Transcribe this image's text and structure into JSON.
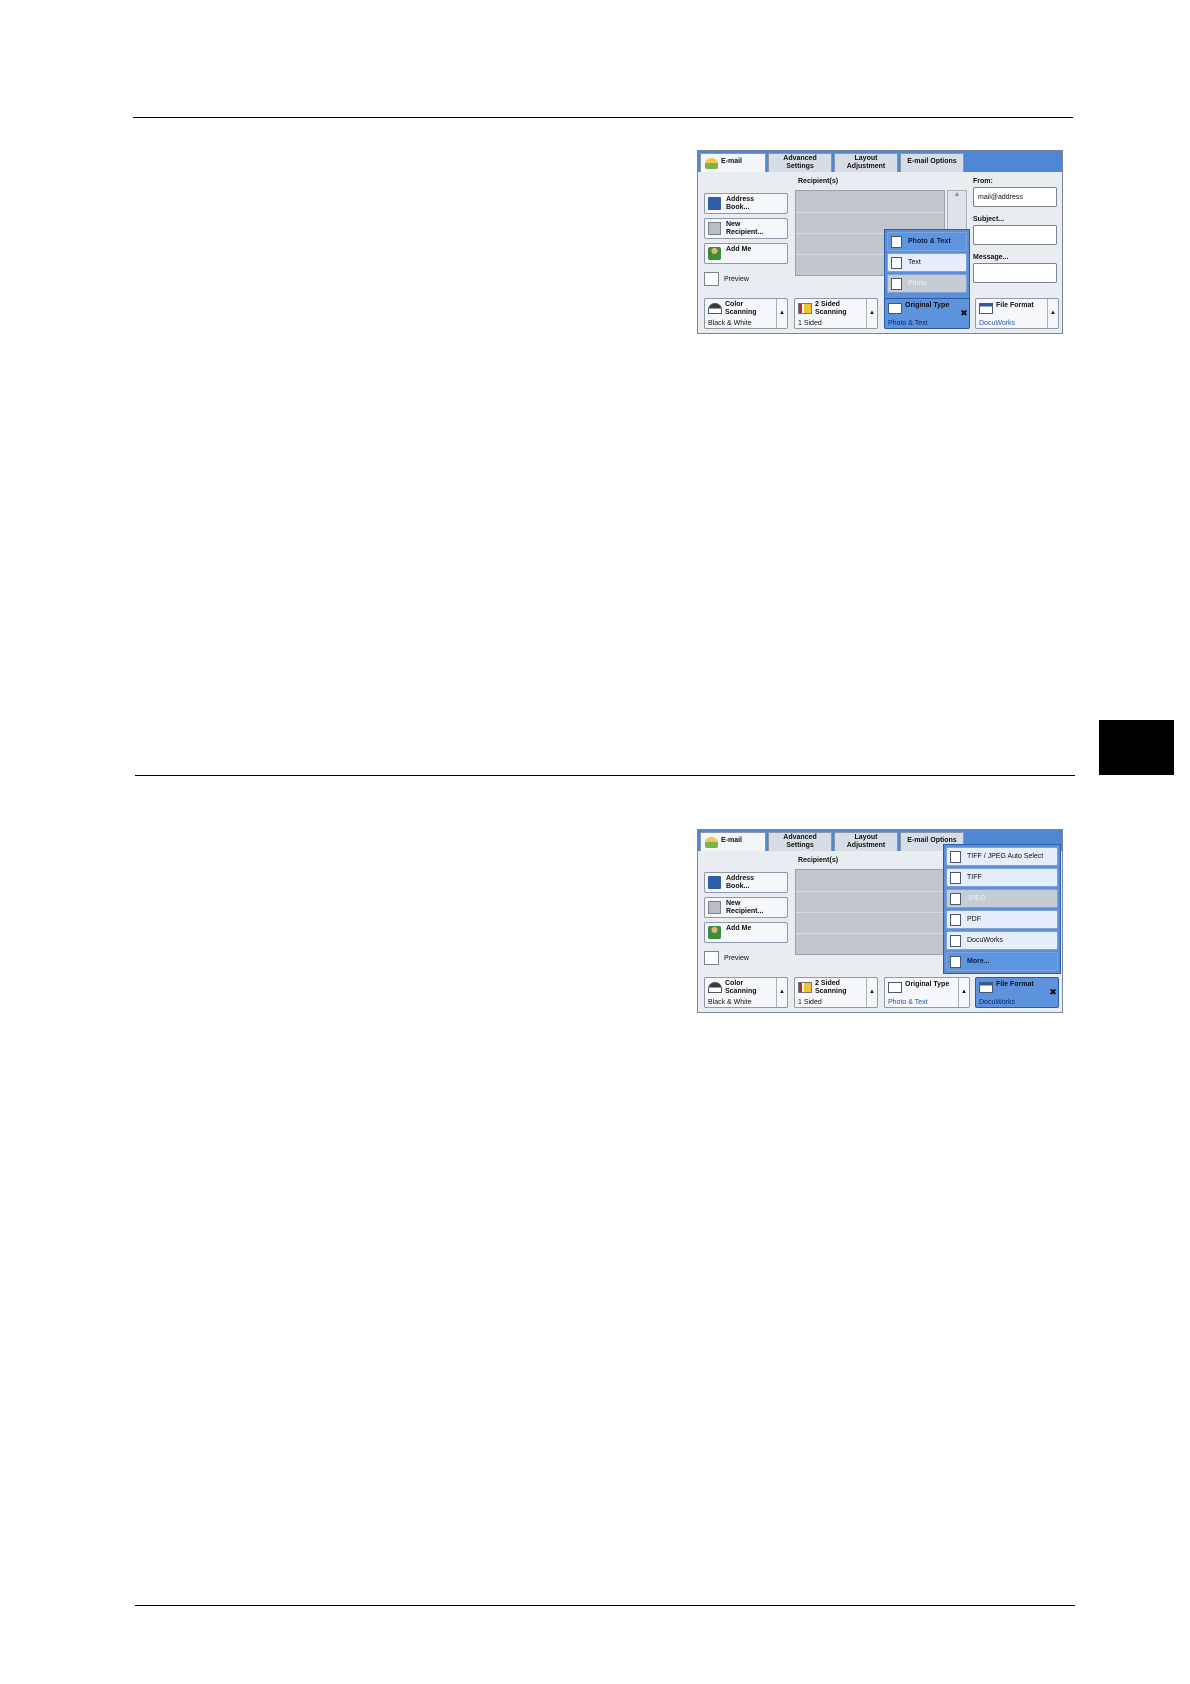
{
  "tabs": {
    "email": "E-mail",
    "advanced": [
      "Advanced",
      "Settings"
    ],
    "layout": [
      "Layout",
      "Adjustment"
    ],
    "options": "E-mail Options"
  },
  "left_buttons": {
    "address_book": [
      "Address",
      "Book..."
    ],
    "new_recipient": [
      "New",
      "Recipient..."
    ],
    "add_me": "Add Me",
    "preview": "Preview"
  },
  "recipients_label": "Recipient(s)",
  "right_fields": {
    "from_label": "From:",
    "from_value": "mail@address",
    "subject_label": "Subject...",
    "message_label": "Message..."
  },
  "features": {
    "color_title": [
      "Color",
      "Scanning"
    ],
    "color_value": "Black & White",
    "sided_title": [
      "2 Sided",
      "Scanning"
    ],
    "sided_value": "1 Sided",
    "original_title": "Original Type",
    "original_value": "Photo & Text",
    "format_title": "File Format",
    "format_value": "DocuWorks"
  },
  "original_type_menu": [
    {
      "label": "Photo & Text",
      "state": "selected"
    },
    {
      "label": "Text",
      "state": "normal"
    },
    {
      "label": "Photo",
      "state": "disabled"
    }
  ],
  "file_format_menu": [
    {
      "label": "TIFF / JPEG Auto Select",
      "state": "normal"
    },
    {
      "label": "TIFF",
      "state": "normal"
    },
    {
      "label": "JPEG",
      "state": "disabled"
    },
    {
      "label": "PDF",
      "state": "normal"
    },
    {
      "label": "DocuWorks",
      "state": "normal"
    },
    {
      "label": "More...",
      "state": "selected"
    }
  ],
  "colors": {
    "accent": "#4f86d6",
    "selected": "#5d92dd",
    "side_tab": "#000000"
  }
}
